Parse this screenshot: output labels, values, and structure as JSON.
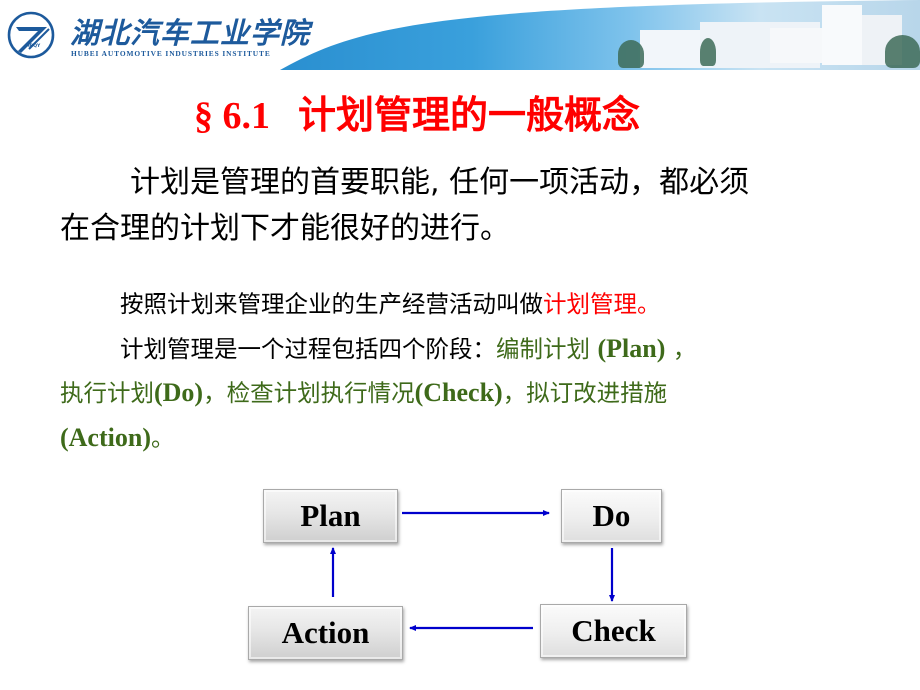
{
  "header": {
    "logo_cn": "湖北汽车工业学院",
    "logo_en": "HUBEI AUTOMOTIVE INDUSTRIES INSTITUTE",
    "logo_badge": "HBQY",
    "banner_image": "campus-buildings-photo"
  },
  "slide": {
    "title_section": "§ 6.1",
    "title_text": "计划管理的一般概念",
    "paragraph1": {
      "line1": "计划是管理的首要职能, 任何一项活动，都必须",
      "line2": "在合理的计划下才能很好的进行。"
    },
    "paragraph2": {
      "sentence1_prefix": "按照计划来管理企业的生产经营活动叫做",
      "sentence1_highlight": "计划管理。",
      "sentence2_prefix": "计划管理是一个过程包括四个阶段：",
      "stage1_cn": "编制计划 ",
      "stage1_en": "(Plan)",
      "sep1": " ，",
      "stage2_cn": "执行计划",
      "stage2_en": "(Do)",
      "sep2": "，检查计划执行情况",
      "stage3_en": "(Check)",
      "sep3": "，拟订改进措施",
      "stage4_en": "(Action)",
      "end": "。"
    },
    "colors": {
      "title": "#ff0000",
      "highlight": "#ff0000",
      "stages": "#3e6a1a",
      "arrows": "#0000cc"
    }
  },
  "diagram": {
    "nodes": [
      {
        "id": "plan",
        "label": "Plan"
      },
      {
        "id": "do",
        "label": "Do"
      },
      {
        "id": "check",
        "label": "Check"
      },
      {
        "id": "action",
        "label": "Action"
      }
    ],
    "edges": [
      {
        "from": "plan",
        "to": "do"
      },
      {
        "from": "do",
        "to": "check"
      },
      {
        "from": "check",
        "to": "action"
      },
      {
        "from": "action",
        "to": "plan"
      }
    ]
  }
}
